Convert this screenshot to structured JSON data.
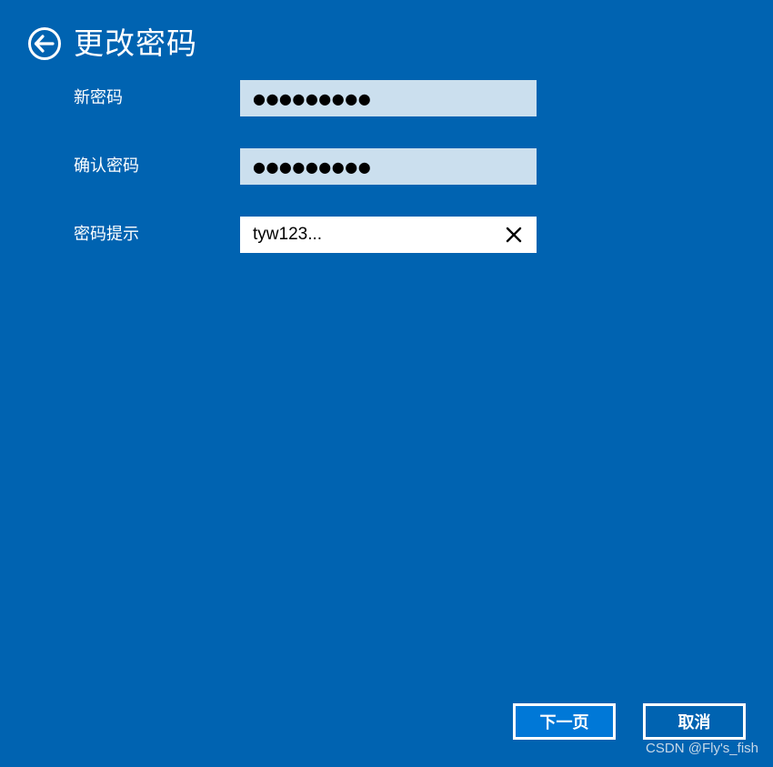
{
  "header": {
    "title": "更改密码",
    "back_icon": "arrow-left-circle-icon"
  },
  "form": {
    "fields": [
      {
        "label": "新密码",
        "value": "●●●●●●●●●",
        "type": "password"
      },
      {
        "label": "确认密码",
        "value": "●●●●●●●●●",
        "type": "password"
      },
      {
        "label": "密码提示",
        "value": "tyw123...",
        "type": "text",
        "clear_icon": "close-icon"
      }
    ]
  },
  "buttons": {
    "next_label": "下一页",
    "cancel_label": "取消"
  },
  "watermark": "CSDN @Fly's_fish",
  "colors": {
    "background": "#0063b1",
    "password_field": "#cbdfee",
    "text_field": "#ffffff",
    "primary_button": "#0078d7"
  }
}
